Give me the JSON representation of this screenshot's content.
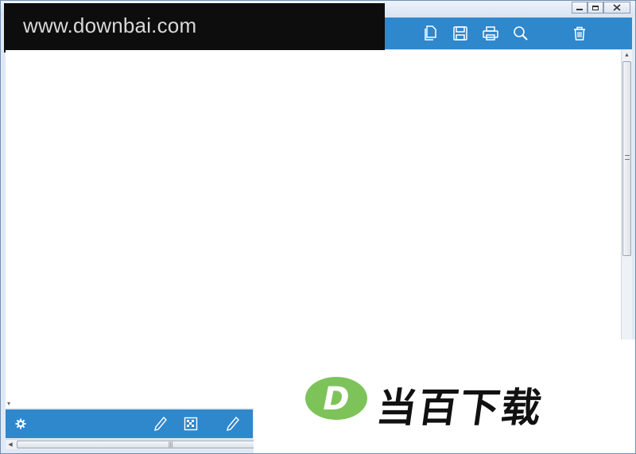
{
  "window": {
    "controls": [
      "minimize",
      "maximize",
      "close"
    ]
  },
  "watermark": {
    "text": "www.downbai.com"
  },
  "toolbar": {
    "icons": [
      "copy-icon",
      "save-icon",
      "print-icon",
      "search-icon",
      "trash-icon"
    ],
    "color": "#2f87cc"
  },
  "bottombar": {
    "icons": [
      "gear-icon",
      "pencil-icon",
      "checker-icon",
      "pen-icon"
    ]
  },
  "logo": {
    "mark_letter": "D",
    "text": "当百下载",
    "mark_color": "#7dc35a"
  }
}
